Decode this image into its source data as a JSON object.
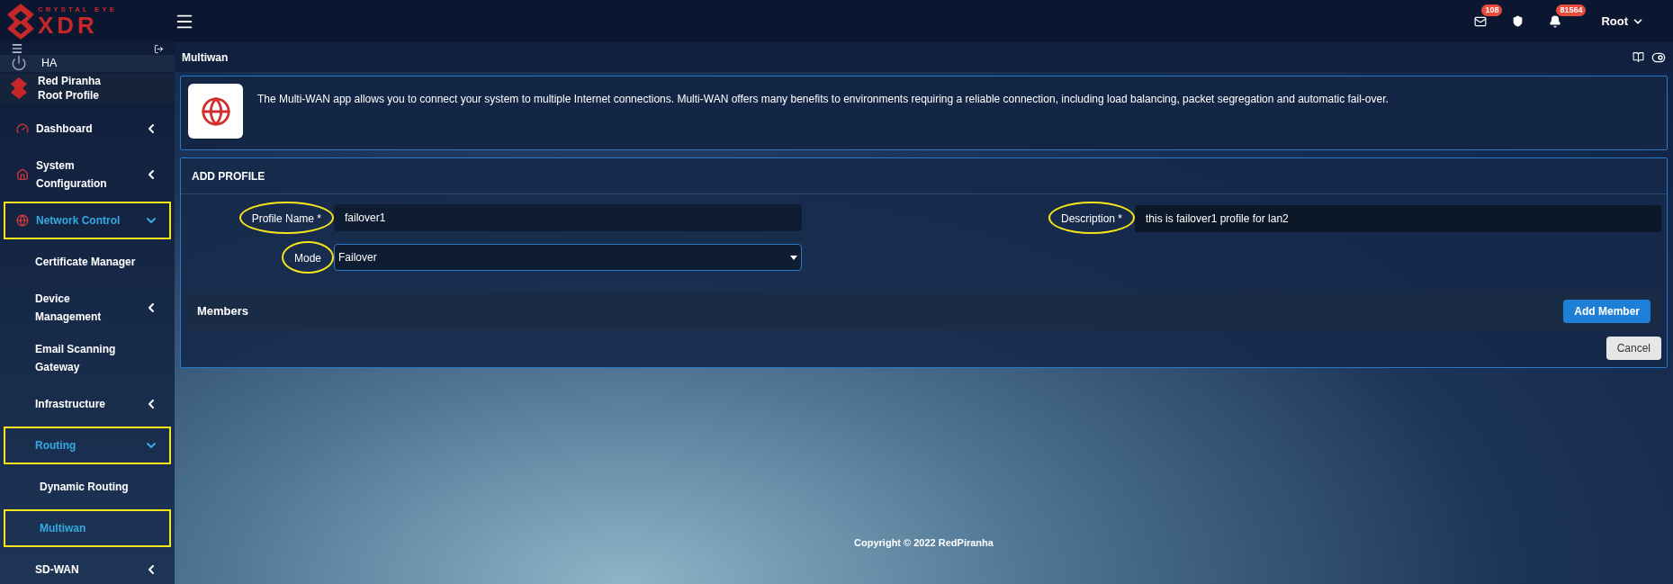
{
  "brand": {
    "top": "CRYSTAL EYE",
    "main": "XDR"
  },
  "topbar": {
    "mail_count": "108",
    "alert_count": "81564",
    "user": "Root"
  },
  "sidebar": {
    "ha": "HA",
    "profile": {
      "org": "Red Piranha",
      "name": "Root Profile"
    },
    "items": [
      {
        "label": "Dashboard",
        "kind": "top",
        "expanded": false,
        "selected": false,
        "highlighted": false
      },
      {
        "label": "System Configuration",
        "kind": "top",
        "expanded": false,
        "selected": false,
        "highlighted": false
      },
      {
        "label": "Network Control",
        "kind": "top",
        "expanded": true,
        "selected": true,
        "highlighted": true
      },
      {
        "label": "Certificate Manager",
        "kind": "sub",
        "selected": false,
        "highlighted": false
      },
      {
        "label": "Device Management",
        "kind": "group",
        "expanded": false,
        "selected": false,
        "highlighted": false
      },
      {
        "label": "Email Scanning Gateway",
        "kind": "sub",
        "selected": false,
        "highlighted": false
      },
      {
        "label": "Infrastructure",
        "kind": "group",
        "expanded": false,
        "selected": false,
        "highlighted": false
      },
      {
        "label": "Routing",
        "kind": "group",
        "expanded": true,
        "selected": true,
        "highlighted": true
      },
      {
        "label": "Dynamic Routing",
        "kind": "leaf",
        "selected": false,
        "highlighted": false
      },
      {
        "label": "Multiwan",
        "kind": "leaf",
        "selected": true,
        "highlighted": true
      },
      {
        "label": "SD-WAN",
        "kind": "group",
        "expanded": false,
        "selected": false,
        "highlighted": false
      }
    ]
  },
  "page_title": "Multiwan",
  "info": "The Multi-WAN app allows you to connect your system to multiple Internet connections. Multi-WAN offers many benefits to environments requiring a reliable connection, including load balancing, packet segregation and automatic fail-over.",
  "form": {
    "title": "ADD PROFILE",
    "profile_name": {
      "label": "Profile Name *",
      "value": "failover1",
      "highlighted": true
    },
    "description": {
      "label": "Description *",
      "value": "this is failover1 profile for lan2",
      "highlighted": true
    },
    "mode": {
      "label": "Mode",
      "value": "Failover",
      "highlighted": true
    },
    "members_title": "Members",
    "add_button": "Add Member",
    "cancel_button": "Cancel"
  },
  "footer": "Copyright © 2022 RedPiranha"
}
